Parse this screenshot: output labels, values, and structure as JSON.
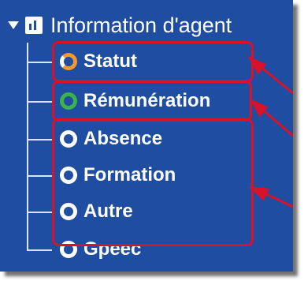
{
  "tree": {
    "header": {
      "label": "Information d'agent",
      "icon": "chart-folder-icon",
      "expanded": true
    },
    "items": [
      {
        "label": "Statut",
        "icon": "pie-ring-icon",
        "ring_color": "#f29a2e"
      },
      {
        "label": "Rémunération",
        "icon": "ring-icon",
        "ring_color": "#3ab34a"
      },
      {
        "label": "Absence",
        "icon": "ring-icon",
        "ring_color": "#ffffff"
      },
      {
        "label": "Formation",
        "icon": "ring-icon",
        "ring_color": "#ffffff"
      },
      {
        "label": "Autre",
        "icon": "ring-icon",
        "ring_color": "#ffffff"
      },
      {
        "label": "Gpeec",
        "icon": "ring-icon",
        "ring_color": "#ffffff"
      }
    ]
  },
  "colors": {
    "panel_background": "#1f4da1",
    "callout": "#d8122a",
    "text": "#ffffff"
  }
}
